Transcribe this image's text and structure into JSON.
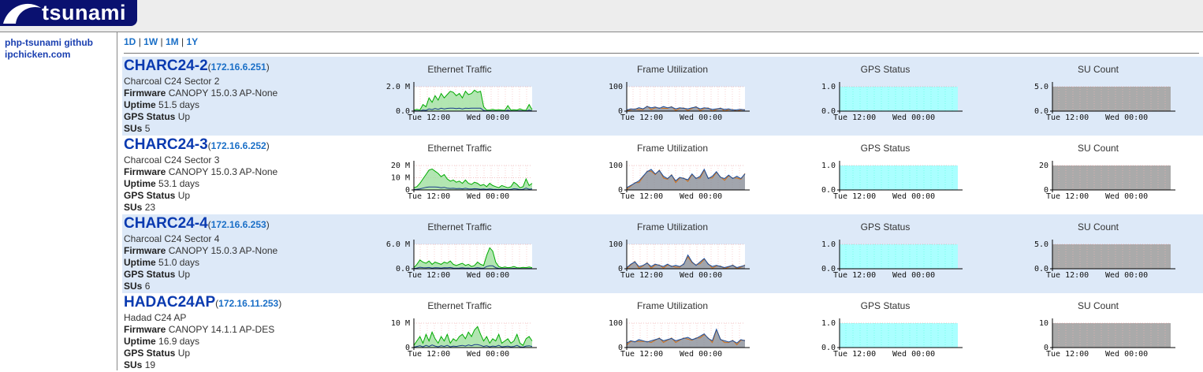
{
  "header": {
    "logo_text": "tsunami"
  },
  "sidebar": {
    "links": [
      "php-tsunami github",
      "ipchicken.com"
    ]
  },
  "ranges": [
    "1D",
    "1W",
    "1M",
    "1Y"
  ],
  "range_separator": "|",
  "labels": {
    "firmware": "Firmware",
    "uptime": "Uptime",
    "gps": "GPS Status",
    "sus": "SUs",
    "graph_titles": [
      "Ethernet Traffic",
      "Frame Utilization",
      "GPS Status",
      "SU Count"
    ],
    "x_ticks": [
      "Tue 12:00",
      "Wed 00:00"
    ]
  },
  "colors": {
    "accent": "#0a3ab0",
    "row_shade": "#dde9f8",
    "green": "#00aa00",
    "gps_fill": "#aaffff",
    "su_fill": "#aaaaaa"
  },
  "devices": [
    {
      "name": "CHARC24-2",
      "ip": "172.16.6.251",
      "desc": "Charcoal C24 Sector 2",
      "firmware": "CANOPY 15.0.3 AP-None",
      "uptime": "51.5 days",
      "gps": "Up",
      "sus": "5",
      "eth_ticks": [
        "2.0 M",
        "0.0"
      ],
      "frame_ticks": [
        "100",
        "0"
      ],
      "gps_ticks": [
        "1.0",
        "0.0"
      ],
      "su_ticks": [
        "5.0",
        "0.0"
      ],
      "eth_series": [
        0.05,
        0.08,
        0.05,
        0.3,
        0.2,
        0.6,
        0.4,
        0.7,
        0.5,
        0.8,
        0.6,
        0.75,
        0.9,
        0.85,
        0.7,
        0.8,
        0.6,
        0.9,
        0.75,
        0.8,
        0.95,
        0.85,
        0.9,
        0.2,
        0.05,
        0.05,
        0.08,
        0.05,
        0.06,
        0.05,
        0.04,
        0.25,
        0.05,
        0.06,
        0.05,
        0.1,
        0.05,
        0.04,
        0.3,
        0.06
      ],
      "frame_series": [
        0.05,
        0.1,
        0.08,
        0.15,
        0.1,
        0.2,
        0.15,
        0.18,
        0.12,
        0.2,
        0.15,
        0.18,
        0.1,
        0.15,
        0.12,
        0.1,
        0.15,
        0.18,
        0.1,
        0.15,
        0.12,
        0.08,
        0.1,
        0.12,
        0.08,
        0.1,
        0.05,
        0.06,
        0.08,
        0.05
      ]
    },
    {
      "name": "CHARC24-3",
      "ip": "172.16.6.252",
      "desc": "Charcoal C24 Sector 3",
      "firmware": "CANOPY 15.0.3 AP-None",
      "uptime": "53.1 days",
      "gps": "Up",
      "sus": "23",
      "eth_ticks": [
        "20 M",
        "10 M",
        "0"
      ],
      "frame_ticks": [
        "100",
        "0"
      ],
      "gps_ticks": [
        "1.0",
        "0.0"
      ],
      "su_ticks": [
        "20",
        "0"
      ],
      "eth_series": [
        0.1,
        0.15,
        0.3,
        0.5,
        0.7,
        0.9,
        0.95,
        0.85,
        0.75,
        0.6,
        0.7,
        0.5,
        0.4,
        0.45,
        0.35,
        0.4,
        0.3,
        0.45,
        0.3,
        0.25,
        0.35,
        0.3,
        0.2,
        0.25,
        0.15,
        0.3,
        0.2,
        0.15,
        0.1,
        0.2,
        0.15,
        0.1,
        0.15,
        0.35,
        0.25,
        0.1,
        0.15,
        0.5,
        0.2,
        0.3
      ],
      "frame_series": [
        0.1,
        0.2,
        0.3,
        0.4,
        0.6,
        0.8,
        0.9,
        0.7,
        0.85,
        0.6,
        0.5,
        0.65,
        0.4,
        0.55,
        0.5,
        0.45,
        0.7,
        0.5,
        0.6,
        0.9,
        0.5,
        0.6,
        0.8,
        0.55,
        0.5,
        0.65,
        0.5,
        0.6,
        0.5,
        0.7
      ]
    },
    {
      "name": "CHARC24-4",
      "ip": "172.16.6.253",
      "desc": "Charcoal C24 Sector 4",
      "firmware": "CANOPY 15.0.3 AP-None",
      "uptime": "51.0 days",
      "gps": "Up",
      "sus": "6",
      "eth_ticks": [
        "6.0 M",
        "0.0"
      ],
      "frame_ticks": [
        "100",
        "0"
      ],
      "gps_ticks": [
        "1.0",
        "0.0"
      ],
      "su_ticks": [
        "5.0",
        "0.0"
      ],
      "eth_series": [
        0.05,
        0.2,
        0.4,
        0.3,
        0.25,
        0.35,
        0.2,
        0.3,
        0.25,
        0.2,
        0.3,
        0.25,
        0.35,
        0.2,
        0.15,
        0.2,
        0.25,
        0.15,
        0.2,
        0.1,
        0.15,
        0.3,
        0.2,
        0.15,
        0.6,
        0.95,
        0.8,
        0.3,
        0.1,
        0.05,
        0.08,
        0.05,
        0.06,
        0.1,
        0.05,
        0.04,
        0.06,
        0.05,
        0.08,
        0.05
      ],
      "frame_series": [
        0.05,
        0.2,
        0.3,
        0.1,
        0.15,
        0.25,
        0.1,
        0.2,
        0.15,
        0.1,
        0.2,
        0.1,
        0.15,
        0.1,
        0.2,
        0.6,
        0.3,
        0.15,
        0.3,
        0.45,
        0.2,
        0.1,
        0.15,
        0.1,
        0.05,
        0.1,
        0.15,
        0.05,
        0.1,
        0.15
      ]
    },
    {
      "name": "HADAC24AP",
      "ip": "172.16.11.253",
      "desc": "Hadad C24 AP",
      "firmware": "CANOPY 14.1.1 AP-DES",
      "uptime": "16.9 days",
      "gps": "Up",
      "sus": "19",
      "eth_ticks": [
        "10 M",
        "0"
      ],
      "frame_ticks": [
        "100",
        "0"
      ],
      "gps_ticks": [
        "1.0",
        "0.0"
      ],
      "su_ticks": [
        "10",
        "0"
      ],
      "eth_series": [
        0.1,
        0.3,
        0.5,
        0.2,
        0.6,
        0.3,
        0.7,
        0.4,
        0.2,
        0.5,
        0.3,
        0.6,
        0.2,
        0.4,
        0.3,
        0.5,
        0.6,
        0.4,
        0.7,
        0.5,
        0.8,
        0.95,
        0.6,
        0.3,
        0.5,
        0.2,
        0.4,
        0.3,
        0.6,
        0.2,
        0.3,
        0.4,
        0.2,
        0.3,
        0.6,
        0.2,
        0.1,
        0.4,
        0.5,
        0.3
      ],
      "frame_series": [
        0.2,
        0.3,
        0.25,
        0.35,
        0.3,
        0.25,
        0.3,
        0.35,
        0.4,
        0.3,
        0.35,
        0.4,
        0.3,
        0.35,
        0.4,
        0.45,
        0.35,
        0.4,
        0.5,
        0.6,
        0.4,
        0.3,
        0.8,
        0.35,
        0.3,
        0.25,
        0.3,
        0.2,
        0.35,
        0.3
      ]
    }
  ]
}
